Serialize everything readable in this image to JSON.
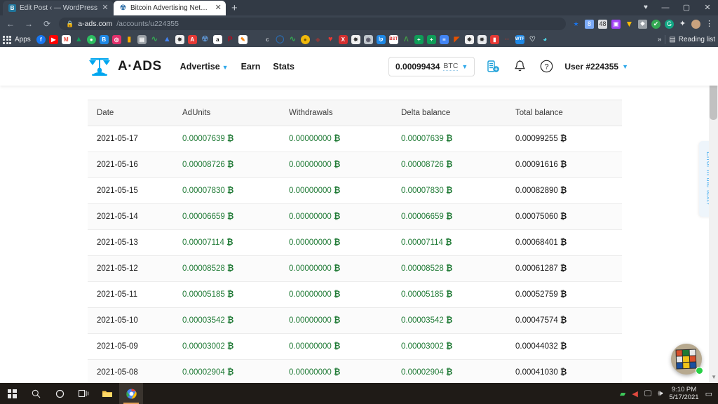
{
  "browser": {
    "tabs": [
      {
        "title": "Edit Post ‹ — WordPress",
        "favicon": "wordpress-icon",
        "active": false
      },
      {
        "title": "Bitcoin Advertising Network | A-A",
        "favicon": "aads-icon",
        "active": true
      }
    ],
    "new_tab_label": "+",
    "window_controls": {
      "profile": "♥",
      "minimize": "—",
      "maximize": "▢",
      "close": "✕"
    },
    "nav": {
      "back": "←",
      "forward": "→",
      "reload": "⟳"
    },
    "url": {
      "lock": "🔒",
      "domain": "a-ads.com",
      "path": "/accounts/u224355"
    },
    "bookmarks": {
      "apps_label": "Apps",
      "items": [
        {
          "name": "facebook-bookmark",
          "glyph": "f",
          "color": "#1877f2"
        },
        {
          "name": "youtube-bookmark",
          "glyph": "▶",
          "color": "#ff0000"
        },
        {
          "name": "gmail-bookmark",
          "glyph": "M",
          "color": "#ea4335"
        },
        {
          "name": "google-drive-bookmark",
          "glyph": "▲",
          "color": "#0f9d58"
        },
        {
          "name": "evernote-bookmark",
          "glyph": "●",
          "color": "#2dbe60"
        },
        {
          "name": "blogger-bookmark",
          "glyph": "B",
          "color": "#ff8000"
        },
        {
          "name": "instagram-bookmark",
          "glyph": "◎",
          "color": "#e1306c"
        },
        {
          "name": "analytics-bookmark",
          "glyph": "▮",
          "color": "#f9ab00"
        },
        {
          "name": "news-bookmark",
          "glyph": "▤",
          "color": "#9aa0a6"
        },
        {
          "name": "trends-bookmark",
          "glyph": "∿",
          "color": "#34a853"
        },
        {
          "name": "drive-bookmark",
          "glyph": "▲",
          "color": "#4285f4"
        },
        {
          "name": "globe-bookmark",
          "glyph": "✸",
          "color": "#ffffff"
        },
        {
          "name": "adsense-bookmark",
          "glyph": "A",
          "color": "#e53935"
        },
        {
          "name": "aads-bookmark",
          "glyph": "∞",
          "color": "#5b8fc9"
        },
        {
          "name": "amazon-bookmark",
          "glyph": "a",
          "color": "#ffffff"
        },
        {
          "name": "pinterest-bookmark",
          "glyph": "P",
          "color": "#bd081c"
        },
        {
          "name": "edit-bookmark",
          "glyph": "✎",
          "color": "#ffffff"
        },
        {
          "name": "c-bookmark",
          "glyph": "c",
          "color": "#c8ccd1"
        },
        {
          "name": "quora-bookmark",
          "glyph": "Q",
          "color": "#2b6cb0"
        },
        {
          "name": "chart-bookmark",
          "glyph": "∿",
          "color": "#34a853"
        },
        {
          "name": "coin-bookmark",
          "glyph": "●",
          "color": "#f0b90b"
        },
        {
          "name": "brave-bookmark",
          "glyph": "◈",
          "color": "#8b3a3a"
        },
        {
          "name": "heart-bookmark",
          "glyph": "♥",
          "color": "#e53935"
        },
        {
          "name": "xxx-bookmark",
          "glyph": "X",
          "color": "#d32f2f"
        },
        {
          "name": "globe2-bookmark",
          "glyph": "✸",
          "color": "#f1f1f1"
        },
        {
          "name": "spiral-bookmark",
          "glyph": "◉",
          "color": "#bfc6cc"
        },
        {
          "name": "lp-bookmark",
          "glyph": "lp",
          "color": "#1e88e5"
        },
        {
          "name": "bst-bookmark",
          "glyph": "B",
          "color": "#ffffff"
        },
        {
          "name": "ar-bookmark",
          "glyph": "Ʌ",
          "color": "#43a047"
        },
        {
          "name": "sheets-bookmark",
          "glyph": "+",
          "color": "#0f9d58"
        },
        {
          "name": "sheets2-bookmark",
          "glyph": "+",
          "color": "#0f9d58"
        },
        {
          "name": "docs-bookmark",
          "glyph": "≡",
          "color": "#4285f4"
        },
        {
          "name": "fire-bookmark",
          "glyph": "◤",
          "color": "#e65100"
        },
        {
          "name": "globe3-bookmark",
          "glyph": "✸",
          "color": "#f1f1f1"
        },
        {
          "name": "globe4-bookmark",
          "glyph": "✸",
          "color": "#e8eaed"
        },
        {
          "name": "red-bookmark",
          "glyph": "▮",
          "color": "#e53935"
        },
        {
          "name": "dots-bookmark",
          "glyph": "··",
          "color": "#c0392b"
        },
        {
          "name": "wtf-bookmark",
          "glyph": "W",
          "color": "#1e88e5"
        },
        {
          "name": "bond-bookmark",
          "glyph": "♡",
          "color": "#cfd8dc"
        },
        {
          "name": "eye-bookmark",
          "glyph": "◕",
          "color": "#4dd0e1"
        }
      ],
      "overflow_label": "»",
      "reading_list_label": "Reading list",
      "reading_list_icon": "list-icon"
    },
    "omni_icons": [
      {
        "name": "bookmark-star-icon",
        "glyph": "★",
        "color": "#1a73e8"
      },
      {
        "name": "extension-blue-icon",
        "glyph": "8",
        "color": "#7baaf7"
      },
      {
        "name": "extension-48-icon",
        "glyph": "48",
        "color": "#dadce0"
      },
      {
        "name": "extension-purple-icon",
        "glyph": "▣",
        "color": "#a142f4"
      },
      {
        "name": "extension-orange-icon",
        "glyph": "▼",
        "color": "#fbbc04"
      },
      {
        "name": "extension-globe-icon",
        "glyph": "✸",
        "color": "#9aa0a6"
      },
      {
        "name": "extension-green-icon",
        "glyph": "✔",
        "color": "#34a853"
      },
      {
        "name": "grammarly-icon",
        "glyph": "G",
        "color": "#11a683"
      },
      {
        "name": "extensions-puzzle-icon",
        "glyph": "✦",
        "color": "#e8eaed"
      },
      {
        "name": "profile-avatar-icon",
        "glyph": "◍",
        "color": "#c9a27e"
      },
      {
        "name": "chrome-menu-icon",
        "glyph": "⋮",
        "color": "#e8eaed"
      }
    ]
  },
  "site": {
    "logo_text": "A·ADS",
    "nav": [
      {
        "label": "Advertise",
        "has_caret": true
      },
      {
        "label": "Earn",
        "has_caret": false
      },
      {
        "label": "Stats",
        "has_caret": false
      }
    ],
    "balance": {
      "amount": "0.00099434",
      "currency": "BTC",
      "caret": "⌄"
    },
    "icons": {
      "deposit": "deposit-coins-icon",
      "notifications": "bell-icon",
      "help": "question-mark-icon"
    },
    "user_label": "User #224355",
    "user_caret": "⌄"
  },
  "table": {
    "columns": [
      "Date",
      "AdUnits",
      "Withdrawals",
      "Delta balance",
      "Total balance"
    ],
    "btc_symbol": "₿",
    "rows": [
      {
        "date": "2021-05-17",
        "adunits": "0.00007639",
        "withdrawals": "0.00000000",
        "delta": "0.00007639",
        "total": "0.00099255"
      },
      {
        "date": "2021-05-16",
        "adunits": "0.00008726",
        "withdrawals": "0.00000000",
        "delta": "0.00008726",
        "total": "0.00091616"
      },
      {
        "date": "2021-05-15",
        "adunits": "0.00007830",
        "withdrawals": "0.00000000",
        "delta": "0.00007830",
        "total": "0.00082890"
      },
      {
        "date": "2021-05-14",
        "adunits": "0.00006659",
        "withdrawals": "0.00000000",
        "delta": "0.00006659",
        "total": "0.00075060"
      },
      {
        "date": "2021-05-13",
        "adunits": "0.00007114",
        "withdrawals": "0.00000000",
        "delta": "0.00007114",
        "total": "0.00068401"
      },
      {
        "date": "2021-05-12",
        "adunits": "0.00008528",
        "withdrawals": "0.00000000",
        "delta": "0.00008528",
        "total": "0.00061287"
      },
      {
        "date": "2021-05-11",
        "adunits": "0.00005185",
        "withdrawals": "0.00000000",
        "delta": "0.00005185",
        "total": "0.00052759"
      },
      {
        "date": "2021-05-10",
        "adunits": "0.00003542",
        "withdrawals": "0.00000000",
        "delta": "0.00003542",
        "total": "0.00047574"
      },
      {
        "date": "2021-05-09",
        "adunits": "0.00003002",
        "withdrawals": "0.00000000",
        "delta": "0.00003002",
        "total": "0.00044032"
      },
      {
        "date": "2021-05-08",
        "adunits": "0.00002904",
        "withdrawals": "0.00000000",
        "delta": "0.00002904",
        "total": "0.00041030"
      }
    ]
  },
  "feedback_tab_label": "Error in the text?",
  "chat_widget": {
    "avatar": "rubiks-cube-avatar",
    "cube_colors": [
      "#d94f2b",
      "#1f7a35",
      "#e8e8e8",
      "#e8e8e8",
      "#f0c419",
      "#d94f2b",
      "#1a4fa0",
      "#f0c419",
      "#1a4fa0"
    ],
    "status": "online"
  },
  "taskbar": {
    "items": [
      {
        "name": "start-button",
        "glyph": "win"
      },
      {
        "name": "search-icon",
        "glyph": "🔍"
      },
      {
        "name": "cortana-icon",
        "glyph": "◯"
      },
      {
        "name": "task-view-icon",
        "glyph": "❏|"
      },
      {
        "name": "file-explorer-icon",
        "glyph": "📁"
      },
      {
        "name": "chrome-taskbar-icon",
        "glyph": "◉"
      }
    ],
    "tray": [
      {
        "name": "tray-green-icon",
        "glyph": "▰"
      },
      {
        "name": "tray-red-icon",
        "glyph": "◀"
      },
      {
        "name": "network-icon",
        "glyph": "🖵"
      },
      {
        "name": "volume-icon",
        "glyph": "🔊"
      }
    ],
    "time": "9:10 PM",
    "date": "5/17/2021",
    "action_center_icon": "notification-icon"
  }
}
